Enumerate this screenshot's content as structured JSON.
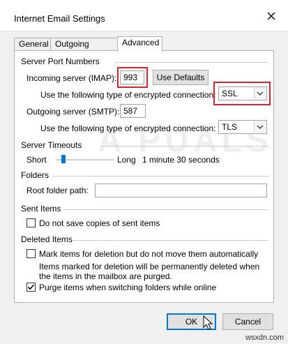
{
  "window": {
    "title": "Internet Email Settings"
  },
  "tabs": [
    {
      "label": "General"
    },
    {
      "label": "Outgoing Server"
    },
    {
      "label": "Advanced"
    }
  ],
  "server_ports": {
    "section": "Server Port Numbers",
    "incoming_label": "Incoming server (IMAP):",
    "incoming_value": "993",
    "use_defaults": "Use Defaults",
    "enc_label": "Use the following type of encrypted connection:",
    "incoming_enc": "SSL",
    "outgoing_label": "Outgoing server (SMTP):",
    "outgoing_value": "587",
    "outgoing_enc": "TLS"
  },
  "timeouts": {
    "section": "Server Timeouts",
    "short": "Short",
    "long": "Long",
    "value": "1 minute 30 seconds"
  },
  "folders": {
    "section": "Folders",
    "root_label": "Root folder path:",
    "root_value": ""
  },
  "sent_items": {
    "section": "Sent Items",
    "no_save": "Do not save copies of sent items"
  },
  "deleted_items": {
    "section": "Deleted Items",
    "mark": "Mark items for deletion but do not move them automatically",
    "note_line1": "Items marked for deletion will be permanently deleted when",
    "note_line2": "the items in the mailbox are purged.",
    "purge": "Purge items when switching folders while online"
  },
  "buttons": {
    "ok": "OK",
    "cancel": "Cancel"
  },
  "watermark": "A PUALS",
  "credit": "wsxdn.com",
  "colors": {
    "highlight": "#d9232c",
    "accent": "#0078d7"
  }
}
